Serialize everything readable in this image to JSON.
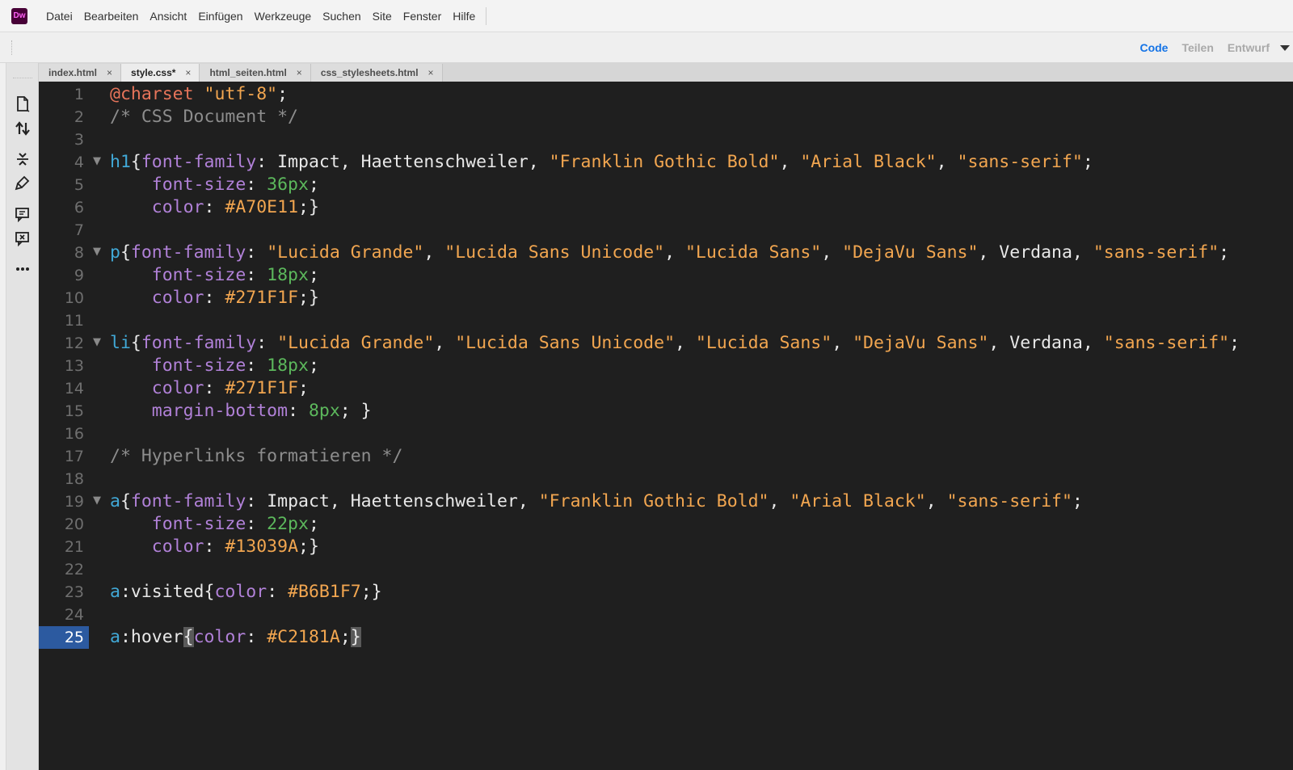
{
  "app": {
    "logo_text": "Dw"
  },
  "menu": [
    "Datei",
    "Bearbeiten",
    "Ansicht",
    "Einfügen",
    "Werkzeuge",
    "Suchen",
    "Site",
    "Fenster",
    "Hilfe"
  ],
  "views": {
    "code": "Code",
    "split": "Teilen",
    "design": "Entwurf"
  },
  "tabs": [
    {
      "label": "index.html",
      "close": "×"
    },
    {
      "label": "style.css*",
      "close": "×"
    },
    {
      "label": "html_seiten.html",
      "close": "×"
    },
    {
      "label": "css_stylesheets.html",
      "close": "×"
    }
  ],
  "left_tools": [
    "open-document-icon",
    "sync-arrows-icon",
    "collapse-icon",
    "format-brush-icon",
    "comment-icon",
    "remove-comment-icon",
    "more-icon"
  ],
  "colors": {
    "accent": "#1473e6",
    "current_line": "#2c5aa0",
    "editor_bg": "#1f1f1f"
  },
  "code": {
    "line_numbers": [
      "1",
      "2",
      "3",
      "4",
      "5",
      "6",
      "7",
      "8",
      "9",
      "10",
      "11",
      "12",
      "13",
      "14",
      "15",
      "16",
      "17",
      "18",
      "19",
      "20",
      "21",
      "22",
      "23",
      "24",
      "25"
    ],
    "lines": [
      [
        {
          "t": "at",
          "v": "@charset "
        },
        {
          "t": "str",
          "v": "\"utf-8\""
        },
        {
          "t": "pun",
          "v": ";"
        }
      ],
      [
        {
          "t": "cmt",
          "v": "/* CSS Document */"
        }
      ],
      [],
      [
        {
          "t": "sel",
          "v": "h1"
        },
        {
          "t": "pun",
          "v": "{"
        },
        {
          "t": "prop",
          "v": "font-family"
        },
        {
          "t": "pun",
          "v": ": "
        },
        {
          "t": "val",
          "v": "Impact, Haettenschweiler, "
        },
        {
          "t": "str",
          "v": "\"Franklin Gothic Bold\""
        },
        {
          "t": "val",
          "v": ", "
        },
        {
          "t": "str",
          "v": "\"Arial Black\""
        },
        {
          "t": "val",
          "v": ", "
        },
        {
          "t": "str",
          "v": "\"sans-serif\""
        },
        {
          "t": "pun",
          "v": ";"
        }
      ],
      [
        {
          "t": "val",
          "v": "    "
        },
        {
          "t": "prop",
          "v": "font-size"
        },
        {
          "t": "pun",
          "v": ": "
        },
        {
          "t": "num",
          "v": "36px"
        },
        {
          "t": "pun",
          "v": ";"
        }
      ],
      [
        {
          "t": "val",
          "v": "    "
        },
        {
          "t": "prop",
          "v": "color"
        },
        {
          "t": "pun",
          "v": ": "
        },
        {
          "t": "hex",
          "v": "#A70E11"
        },
        {
          "t": "pun",
          "v": ";}"
        }
      ],
      [],
      [
        {
          "t": "sel",
          "v": "p"
        },
        {
          "t": "pun",
          "v": "{"
        },
        {
          "t": "prop",
          "v": "font-family"
        },
        {
          "t": "pun",
          "v": ": "
        },
        {
          "t": "str",
          "v": "\"Lucida Grande\""
        },
        {
          "t": "val",
          "v": ", "
        },
        {
          "t": "str",
          "v": "\"Lucida Sans Unicode\""
        },
        {
          "t": "val",
          "v": ", "
        },
        {
          "t": "str",
          "v": "\"Lucida Sans\""
        },
        {
          "t": "val",
          "v": ", "
        },
        {
          "t": "str",
          "v": "\"DejaVu Sans\""
        },
        {
          "t": "val",
          "v": ", Verdana, "
        },
        {
          "t": "str",
          "v": "\"sans-serif\""
        },
        {
          "t": "pun",
          "v": ";"
        }
      ],
      [
        {
          "t": "val",
          "v": "    "
        },
        {
          "t": "prop",
          "v": "font-size"
        },
        {
          "t": "pun",
          "v": ": "
        },
        {
          "t": "num",
          "v": "18px"
        },
        {
          "t": "pun",
          "v": ";"
        }
      ],
      [
        {
          "t": "val",
          "v": "    "
        },
        {
          "t": "prop",
          "v": "color"
        },
        {
          "t": "pun",
          "v": ": "
        },
        {
          "t": "hex",
          "v": "#271F1F"
        },
        {
          "t": "pun",
          "v": ";}"
        }
      ],
      [],
      [
        {
          "t": "sel",
          "v": "li"
        },
        {
          "t": "pun",
          "v": "{"
        },
        {
          "t": "prop",
          "v": "font-family"
        },
        {
          "t": "pun",
          "v": ": "
        },
        {
          "t": "str",
          "v": "\"Lucida Grande\""
        },
        {
          "t": "val",
          "v": ", "
        },
        {
          "t": "str",
          "v": "\"Lucida Sans Unicode\""
        },
        {
          "t": "val",
          "v": ", "
        },
        {
          "t": "str",
          "v": "\"Lucida Sans\""
        },
        {
          "t": "val",
          "v": ", "
        },
        {
          "t": "str",
          "v": "\"DejaVu Sans\""
        },
        {
          "t": "val",
          "v": ", Verdana, "
        },
        {
          "t": "str",
          "v": "\"sans-serif\""
        },
        {
          "t": "pun",
          "v": ";"
        }
      ],
      [
        {
          "t": "val",
          "v": "    "
        },
        {
          "t": "prop",
          "v": "font-size"
        },
        {
          "t": "pun",
          "v": ": "
        },
        {
          "t": "num",
          "v": "18px"
        },
        {
          "t": "pun",
          "v": ";"
        }
      ],
      [
        {
          "t": "val",
          "v": "    "
        },
        {
          "t": "prop",
          "v": "color"
        },
        {
          "t": "pun",
          "v": ": "
        },
        {
          "t": "hex",
          "v": "#271F1F"
        },
        {
          "t": "pun",
          "v": ";"
        }
      ],
      [
        {
          "t": "val",
          "v": "    "
        },
        {
          "t": "prop",
          "v": "margin-bottom"
        },
        {
          "t": "pun",
          "v": ": "
        },
        {
          "t": "num",
          "v": "8px"
        },
        {
          "t": "pun",
          "v": "; }"
        }
      ],
      [],
      [
        {
          "t": "cmt",
          "v": "/* Hyperlinks formatieren */"
        }
      ],
      [],
      [
        {
          "t": "sel",
          "v": "a"
        },
        {
          "t": "pun",
          "v": "{"
        },
        {
          "t": "prop",
          "v": "font-family"
        },
        {
          "t": "pun",
          "v": ": "
        },
        {
          "t": "val",
          "v": "Impact, Haettenschweiler, "
        },
        {
          "t": "str",
          "v": "\"Franklin Gothic Bold\""
        },
        {
          "t": "val",
          "v": ", "
        },
        {
          "t": "str",
          "v": "\"Arial Black\""
        },
        {
          "t": "val",
          "v": ", "
        },
        {
          "t": "str",
          "v": "\"sans-serif\""
        },
        {
          "t": "pun",
          "v": ";"
        }
      ],
      [
        {
          "t": "val",
          "v": "    "
        },
        {
          "t": "prop",
          "v": "font-size"
        },
        {
          "t": "pun",
          "v": ": "
        },
        {
          "t": "num",
          "v": "22px"
        },
        {
          "t": "pun",
          "v": ";"
        }
      ],
      [
        {
          "t": "val",
          "v": "    "
        },
        {
          "t": "prop",
          "v": "color"
        },
        {
          "t": "pun",
          "v": ": "
        },
        {
          "t": "hex",
          "v": "#13039A"
        },
        {
          "t": "pun",
          "v": ";}"
        }
      ],
      [],
      [
        {
          "t": "sel",
          "v": "a"
        },
        {
          "t": "val",
          "v": ":visited"
        },
        {
          "t": "pun",
          "v": "{"
        },
        {
          "t": "prop",
          "v": "color"
        },
        {
          "t": "pun",
          "v": ": "
        },
        {
          "t": "hex",
          "v": "#B6B1F7"
        },
        {
          "t": "pun",
          "v": ";}"
        }
      ],
      [],
      [
        {
          "t": "sel",
          "v": "a"
        },
        {
          "t": "val",
          "v": ":hover"
        },
        {
          "t": "brace-hl",
          "v": "{"
        },
        {
          "t": "prop",
          "v": "color"
        },
        {
          "t": "pun",
          "v": ": "
        },
        {
          "t": "hex",
          "v": "#C2181A"
        },
        {
          "t": "pun",
          "v": ";"
        },
        {
          "t": "brace-hl",
          "v": "}"
        }
      ]
    ],
    "foldable_lines": [
      4,
      8,
      12,
      19
    ],
    "current_line": 25,
    "fold_glyph": "▼"
  }
}
